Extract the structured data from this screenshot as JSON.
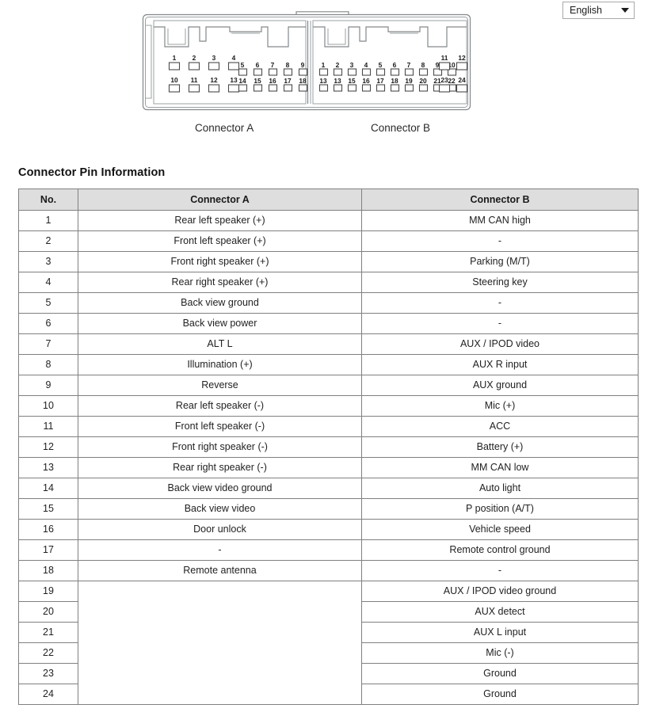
{
  "language_select": {
    "selected": "English",
    "caret_icon": "chevron-down-icon"
  },
  "diagram": {
    "connector_a": {
      "caption": "Connector A",
      "left_block_row1": [
        "1",
        "2",
        "3",
        "4"
      ],
      "left_block_row2": [
        "10",
        "11",
        "12",
        "13"
      ],
      "right_block_row1": [
        "5",
        "6",
        "7",
        "8",
        "9"
      ],
      "right_block_row2": [
        "14",
        "15",
        "16",
        "17",
        "18"
      ]
    },
    "connector_b": {
      "caption": "Connector B",
      "left_block_row1": [
        "1",
        "2",
        "3",
        "4",
        "5",
        "6",
        "7",
        "8",
        "9",
        "10"
      ],
      "left_block_row2": [
        "13",
        "13",
        "15",
        "16",
        "17",
        "18",
        "19",
        "20",
        "21",
        "22"
      ],
      "right_block_row1": [
        "11",
        "12"
      ],
      "right_block_row2": [
        "23",
        "24"
      ]
    }
  },
  "section": {
    "title": "Connector Pin Information"
  },
  "table": {
    "headers": [
      "No.",
      "Connector A",
      "Connector B"
    ],
    "rows": [
      {
        "no": "1",
        "a": "Rear left speaker (+)",
        "b": "MM CAN high"
      },
      {
        "no": "2",
        "a": "Front left speaker (+)",
        "b": "-"
      },
      {
        "no": "3",
        "a": "Front right speaker (+)",
        "b": "Parking (M/T)"
      },
      {
        "no": "4",
        "a": "Rear right speaker (+)",
        "b": "Steering key"
      },
      {
        "no": "5",
        "a": "Back view ground",
        "b": "-"
      },
      {
        "no": "6",
        "a": "Back view power",
        "b": "-"
      },
      {
        "no": "7",
        "a": "ALT L",
        "b": "AUX / IPOD video"
      },
      {
        "no": "8",
        "a": "Illumination (+)",
        "b": "AUX R input"
      },
      {
        "no": "9",
        "a": "Reverse",
        "b": "AUX ground"
      },
      {
        "no": "10",
        "a": "Rear left speaker (-)",
        "b": "Mic (+)"
      },
      {
        "no": "11",
        "a": "Front left speaker (-)",
        "b": "ACC"
      },
      {
        "no": "12",
        "a": "Front right speaker (-)",
        "b": "Battery (+)"
      },
      {
        "no": "13",
        "a": "Rear right speaker (-)",
        "b": "MM CAN low"
      },
      {
        "no": "14",
        "a": "Back view video ground",
        "b": "Auto light"
      },
      {
        "no": "15",
        "a": "Back view video",
        "b": "P position (A/T)"
      },
      {
        "no": "16",
        "a": "Door unlock",
        "b": "Vehicle speed"
      },
      {
        "no": "17",
        "a": "-",
        "b": "Remote control ground"
      },
      {
        "no": "18",
        "a": "Remote antenna",
        "b": "-"
      },
      {
        "no": "19",
        "a": null,
        "b": "AUX / IPOD video ground"
      },
      {
        "no": "20",
        "a": null,
        "b": "AUX detect"
      },
      {
        "no": "21",
        "a": null,
        "b": "AUX L input"
      },
      {
        "no": "22",
        "a": null,
        "b": "Mic (-)"
      },
      {
        "no": "23",
        "a": null,
        "b": "Ground"
      },
      {
        "no": "24",
        "a": null,
        "b": "Ground"
      }
    ],
    "merged_empty_from_row": 19
  },
  "colors": {
    "header_bg": "#dedede",
    "border": "#808080",
    "text": "#222222",
    "diagram_line": "#6e7376",
    "page_bg": "#ffffff"
  }
}
